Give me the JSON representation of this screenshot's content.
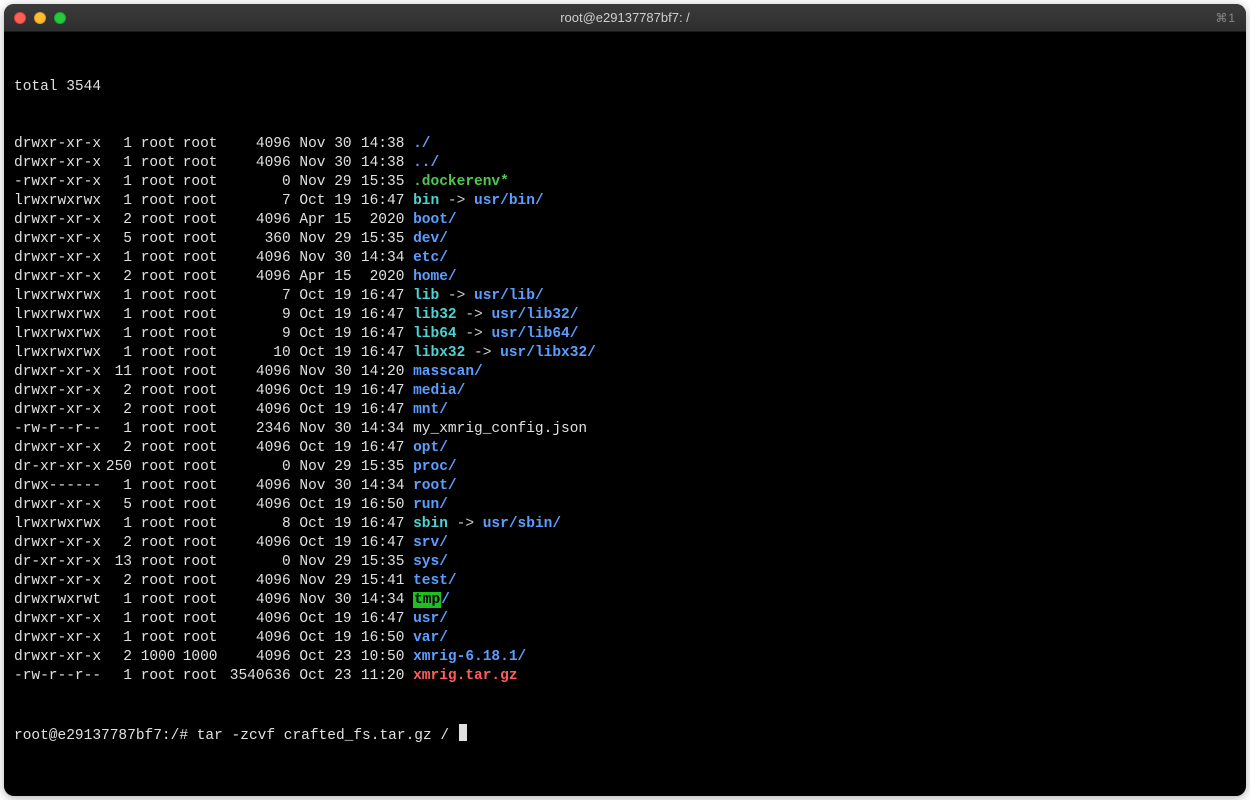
{
  "window": {
    "title": "root@e29137787bf7: /",
    "right_badge": "⌘1"
  },
  "terminal": {
    "total_line": "total 3544",
    "entries": [
      {
        "perms": "drwxr-xr-x",
        "links": "1",
        "owner": "root",
        "group": "root",
        "size": "4096",
        "date": "Nov 30",
        "time": "14:38",
        "name": "./",
        "type": "dir"
      },
      {
        "perms": "drwxr-xr-x",
        "links": "1",
        "owner": "root",
        "group": "root",
        "size": "4096",
        "date": "Nov 30",
        "time": "14:38",
        "name": "../",
        "type": "dir"
      },
      {
        "perms": "-rwxr-xr-x",
        "links": "1",
        "owner": "root",
        "group": "root",
        "size": "0",
        "date": "Nov 29",
        "time": "15:35",
        "name": ".dockerenv*",
        "type": "exec"
      },
      {
        "perms": "lrwxrwxrwx",
        "links": "1",
        "owner": "root",
        "group": "root",
        "size": "7",
        "date": "Oct 19",
        "time": "16:47",
        "name": "bin",
        "type": "link",
        "arrow": " -> ",
        "target": "usr/bin/",
        "target_type": "dir"
      },
      {
        "perms": "drwxr-xr-x",
        "links": "2",
        "owner": "root",
        "group": "root",
        "size": "4096",
        "date": "Apr 15",
        "time": "2020",
        "name": "boot/",
        "type": "dir"
      },
      {
        "perms": "drwxr-xr-x",
        "links": "5",
        "owner": "root",
        "group": "root",
        "size": "360",
        "date": "Nov 29",
        "time": "15:35",
        "name": "dev/",
        "type": "dir"
      },
      {
        "perms": "drwxr-xr-x",
        "links": "1",
        "owner": "root",
        "group": "root",
        "size": "4096",
        "date": "Nov 30",
        "time": "14:34",
        "name": "etc/",
        "type": "dir"
      },
      {
        "perms": "drwxr-xr-x",
        "links": "2",
        "owner": "root",
        "group": "root",
        "size": "4096",
        "date": "Apr 15",
        "time": "2020",
        "name": "home/",
        "type": "dir"
      },
      {
        "perms": "lrwxrwxrwx",
        "links": "1",
        "owner": "root",
        "group": "root",
        "size": "7",
        "date": "Oct 19",
        "time": "16:47",
        "name": "lib",
        "type": "link",
        "arrow": " -> ",
        "target": "usr/lib/",
        "target_type": "dir"
      },
      {
        "perms": "lrwxrwxrwx",
        "links": "1",
        "owner": "root",
        "group": "root",
        "size": "9",
        "date": "Oct 19",
        "time": "16:47",
        "name": "lib32",
        "type": "link",
        "arrow": " -> ",
        "target": "usr/lib32/",
        "target_type": "dir"
      },
      {
        "perms": "lrwxrwxrwx",
        "links": "1",
        "owner": "root",
        "group": "root",
        "size": "9",
        "date": "Oct 19",
        "time": "16:47",
        "name": "lib64",
        "type": "link",
        "arrow": " -> ",
        "target": "usr/lib64/",
        "target_type": "dir"
      },
      {
        "perms": "lrwxrwxrwx",
        "links": "1",
        "owner": "root",
        "group": "root",
        "size": "10",
        "date": "Oct 19",
        "time": "16:47",
        "name": "libx32",
        "type": "link",
        "arrow": " -> ",
        "target": "usr/libx32/",
        "target_type": "dir"
      },
      {
        "perms": "drwxr-xr-x",
        "links": "11",
        "owner": "root",
        "group": "root",
        "size": "4096",
        "date": "Nov 30",
        "time": "14:20",
        "name": "masscan/",
        "type": "dir"
      },
      {
        "perms": "drwxr-xr-x",
        "links": "2",
        "owner": "root",
        "group": "root",
        "size": "4096",
        "date": "Oct 19",
        "time": "16:47",
        "name": "media/",
        "type": "dir"
      },
      {
        "perms": "drwxr-xr-x",
        "links": "2",
        "owner": "root",
        "group": "root",
        "size": "4096",
        "date": "Oct 19",
        "time": "16:47",
        "name": "mnt/",
        "type": "dir"
      },
      {
        "perms": "-rw-r--r--",
        "links": "1",
        "owner": "root",
        "group": "root",
        "size": "2346",
        "date": "Nov 30",
        "time": "14:34",
        "name": "my_xmrig_config.json",
        "type": "plain"
      },
      {
        "perms": "drwxr-xr-x",
        "links": "2",
        "owner": "root",
        "group": "root",
        "size": "4096",
        "date": "Oct 19",
        "time": "16:47",
        "name": "opt/",
        "type": "dir"
      },
      {
        "perms": "dr-xr-xr-x",
        "links": "250",
        "owner": "root",
        "group": "root",
        "size": "0",
        "date": "Nov 29",
        "time": "15:35",
        "name": "proc/",
        "type": "dir"
      },
      {
        "perms": "drwx------",
        "links": "1",
        "owner": "root",
        "group": "root",
        "size": "4096",
        "date": "Nov 30",
        "time": "14:34",
        "name": "root/",
        "type": "dir"
      },
      {
        "perms": "drwxr-xr-x",
        "links": "5",
        "owner": "root",
        "group": "root",
        "size": "4096",
        "date": "Oct 19",
        "time": "16:50",
        "name": "run/",
        "type": "dir"
      },
      {
        "perms": "lrwxrwxrwx",
        "links": "1",
        "owner": "root",
        "group": "root",
        "size": "8",
        "date": "Oct 19",
        "time": "16:47",
        "name": "sbin",
        "type": "link",
        "arrow": " -> ",
        "target": "usr/sbin/",
        "target_type": "dir"
      },
      {
        "perms": "drwxr-xr-x",
        "links": "2",
        "owner": "root",
        "group": "root",
        "size": "4096",
        "date": "Oct 19",
        "time": "16:47",
        "name": "srv/",
        "type": "dir"
      },
      {
        "perms": "dr-xr-xr-x",
        "links": "13",
        "owner": "root",
        "group": "root",
        "size": "0",
        "date": "Nov 29",
        "time": "15:35",
        "name": "sys/",
        "type": "dir"
      },
      {
        "perms": "drwxr-xr-x",
        "links": "2",
        "owner": "root",
        "group": "root",
        "size": "4096",
        "date": "Nov 29",
        "time": "15:41",
        "name": "test/",
        "type": "dir"
      },
      {
        "perms": "drwxrwxrwt",
        "links": "1",
        "owner": "root",
        "group": "root",
        "size": "4096",
        "date": "Nov 30",
        "time": "14:34",
        "name": "tmp",
        "type": "sticky",
        "suffix": "/",
        "suffix_type": "dir"
      },
      {
        "perms": "drwxr-xr-x",
        "links": "1",
        "owner": "root",
        "group": "root",
        "size": "4096",
        "date": "Oct 19",
        "time": "16:47",
        "name": "usr/",
        "type": "dir"
      },
      {
        "perms": "drwxr-xr-x",
        "links": "1",
        "owner": "root",
        "group": "root",
        "size": "4096",
        "date": "Oct 19",
        "time": "16:50",
        "name": "var/",
        "type": "dir"
      },
      {
        "perms": "drwxr-xr-x",
        "links": "2",
        "owner": "1000",
        "group": "1000",
        "size": "4096",
        "date": "Oct 23",
        "time": "10:50",
        "name": "xmrig-6.18.1/",
        "type": "dir"
      },
      {
        "perms": "-rw-r--r--",
        "links": "1",
        "owner": "root",
        "group": "root",
        "size": "3540636",
        "date": "Oct 23",
        "time": "11:20",
        "name": "xmrig.tar.gz",
        "type": "archive"
      }
    ],
    "prompt": "root@e29137787bf7:/# ",
    "command": "tar -zcvf crafted_fs.tar.gz / "
  }
}
